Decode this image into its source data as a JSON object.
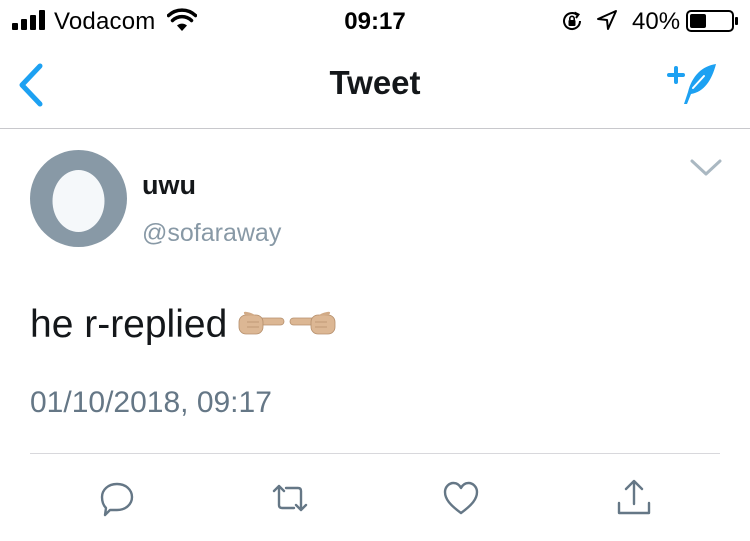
{
  "status_bar": {
    "carrier": "Vodacom",
    "time": "09:17",
    "battery_percent": "40%",
    "battery_level": 0.4
  },
  "nav": {
    "title": "Tweet",
    "back_icon": "chevron-left-icon",
    "compose_icon": "compose-tweet-icon"
  },
  "tweet": {
    "display_name": "uwu",
    "handle": "@sofaraway",
    "text": "he r-replied",
    "emoji": [
      "pointing-right-hand",
      "pointing-left-hand"
    ],
    "timestamp": "01/10/2018, 09:17"
  },
  "actions": [
    {
      "icon": "reply-icon"
    },
    {
      "icon": "retweet-icon"
    },
    {
      "icon": "like-icon"
    },
    {
      "icon": "share-icon"
    }
  ],
  "colors": {
    "accent": "#1da1f2",
    "text": "#14171a",
    "secondary": "#657786",
    "avatar_bg": "#8899a6"
  }
}
